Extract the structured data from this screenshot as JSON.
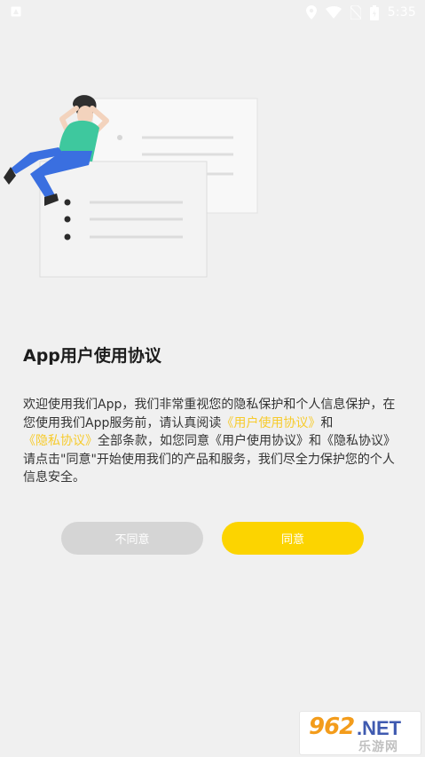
{
  "status_bar": {
    "time": "5:35"
  },
  "dialog": {
    "title": "App用户使用协议",
    "body": {
      "part1": "欢迎使用我们App，我们非常重视您的隐私保护和个人信息保护，在您使用我们App服务前，请认真阅读",
      "link_user_agreement": "《用户使用协议》",
      "part2": "和",
      "link_privacy": "《隐私协议》",
      "part3": "全部条款，如您同意《用户使用协议》和《隐私协议》请点击\"同意\"开始使用我们的产品和服务，我们尽全力保护您的个人信息安全。"
    },
    "disagree_label": "不同意",
    "agree_label": "同意"
  },
  "watermark": {
    "number": "962",
    "suffix": ".NET",
    "subtitle": "乐游网"
  },
  "colors": {
    "background": "#f0f0f0",
    "link": "#f7cb2c",
    "agree_button": "#fcd400",
    "disagree_button": "#d5d5d5"
  },
  "icons": [
    "notification-icon",
    "location-icon",
    "wifi-icon",
    "sim-off-icon",
    "battery-icon"
  ]
}
